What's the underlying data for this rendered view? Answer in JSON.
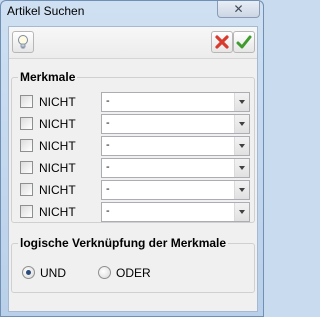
{
  "window": {
    "title": "Artikel Suchen",
    "close_glyph": "✕"
  },
  "toolbar": {
    "info_icon": "lightbulb-icon",
    "cancel_icon": "red-x-icon",
    "confirm_icon": "green-check-icon"
  },
  "merkmale": {
    "label": "Merkmale",
    "rows": [
      {
        "checkbox_label": "NICHT",
        "checked": false,
        "value": "-"
      },
      {
        "checkbox_label": "NICHT",
        "checked": false,
        "value": "-"
      },
      {
        "checkbox_label": "NICHT",
        "checked": false,
        "value": "-"
      },
      {
        "checkbox_label": "NICHT",
        "checked": false,
        "value": "-"
      },
      {
        "checkbox_label": "NICHT",
        "checked": false,
        "value": "-"
      },
      {
        "checkbox_label": "NICHT",
        "checked": false,
        "value": "-"
      }
    ]
  },
  "verknuepfung": {
    "label": "logische Verknüpfung der Merkmale",
    "options": [
      {
        "label": "UND",
        "selected": true
      },
      {
        "label": "ODER",
        "selected": false
      }
    ]
  },
  "colors": {
    "title_bg": "#c5d9ef",
    "client_bg": "#f0f0f0",
    "cancel_red": "#d93a2b",
    "confirm_green": "#3f9b2c"
  }
}
